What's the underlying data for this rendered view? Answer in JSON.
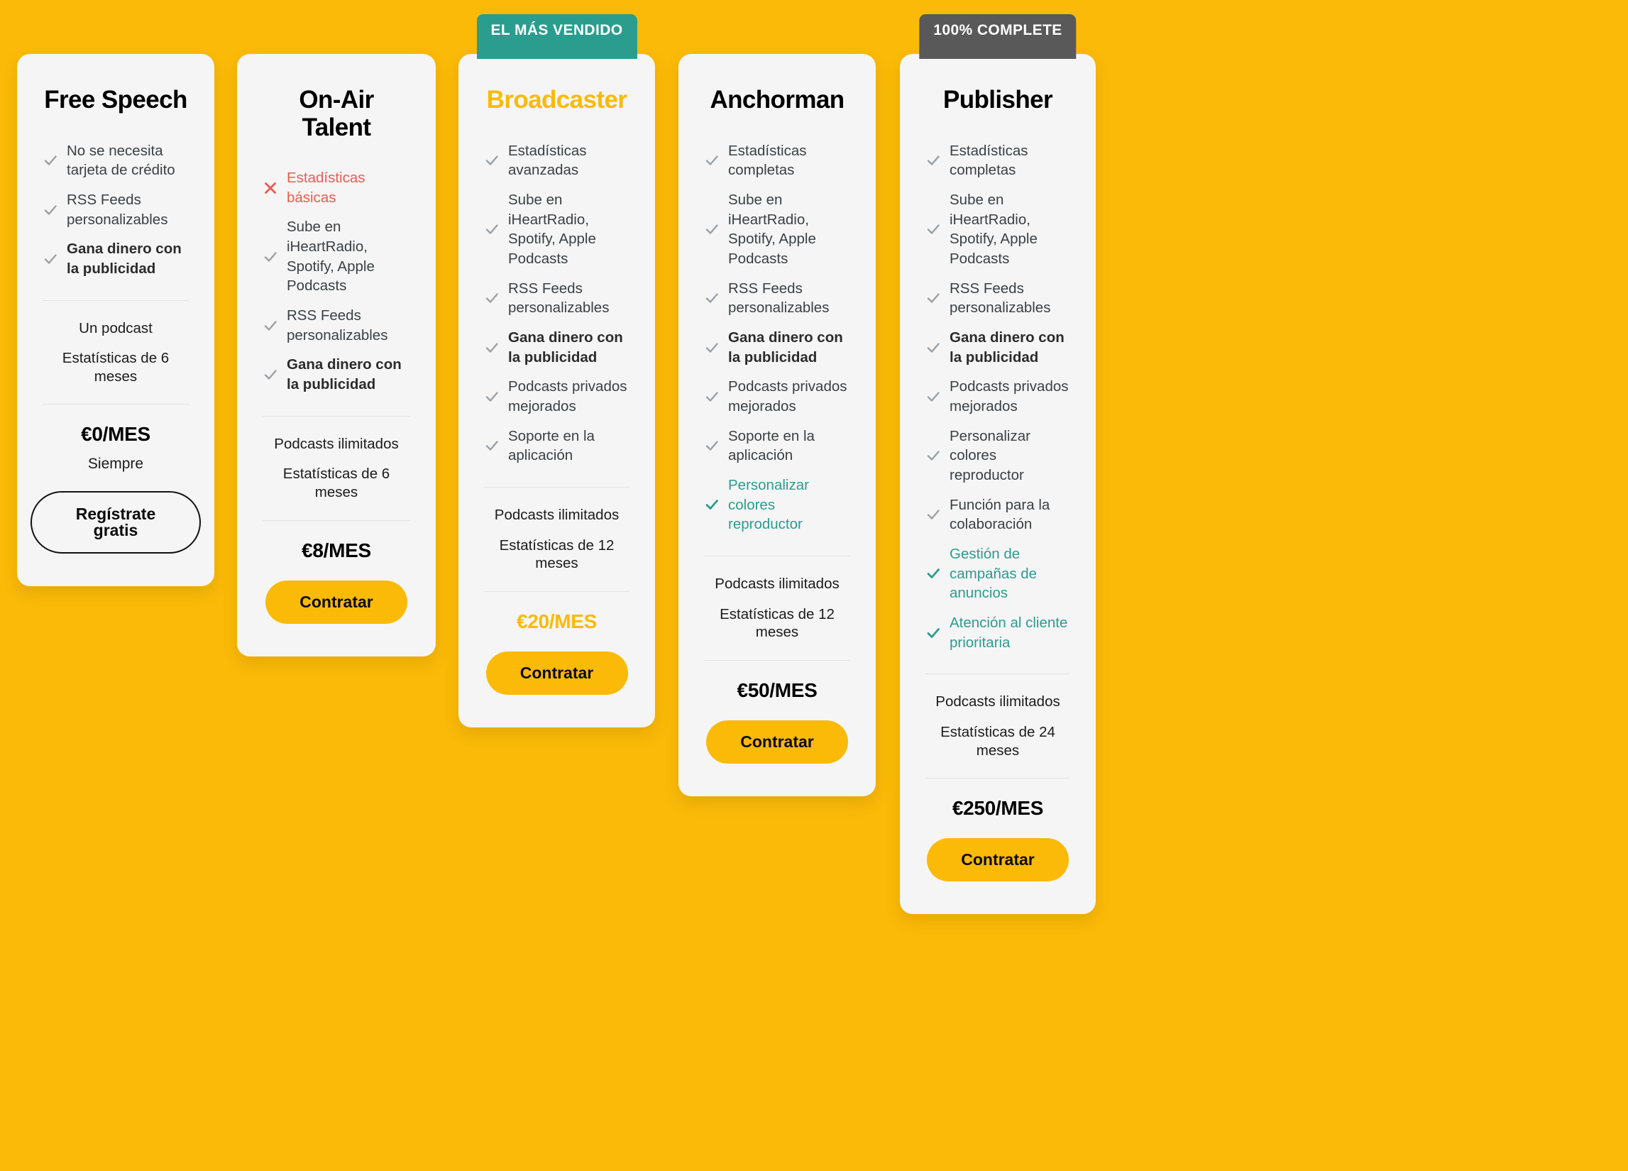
{
  "theme": {
    "background": "#FBBA07",
    "card_background": "#F5F5F5",
    "accent": "#FBBA07",
    "teal": "#2A9D8F",
    "badge_gray": "#595959",
    "negative": "#EE5A52",
    "text": "#3C4043"
  },
  "plans": [
    {
      "id": "free-speech",
      "badge": null,
      "title": "Free Speech",
      "title_accent": false,
      "features": [
        {
          "mark": "check",
          "text": "No se necesita tarjeta de crédito",
          "style": "normal"
        },
        {
          "mark": "check",
          "text": "RSS Feeds personalizables",
          "style": "normal"
        },
        {
          "mark": "check",
          "text": "Gana dinero con la publicidad",
          "style": "strong"
        }
      ],
      "specs": [
        "Un podcast",
        "Estatísticas de 6 meses"
      ],
      "price": "€0/MES",
      "price_accent": false,
      "price_note": "Siempre",
      "cta_label": "Regístrate gratis",
      "cta_style": "outline"
    },
    {
      "id": "on-air-talent",
      "badge": null,
      "title": "On-Air Talent",
      "title_accent": false,
      "features": [
        {
          "mark": "cross",
          "text": "Estadísticas básicas",
          "style": "negative"
        },
        {
          "mark": "check",
          "text": "Sube en iHeartRadio, Spotify, Apple Podcasts",
          "style": "normal"
        },
        {
          "mark": "check",
          "text": "RSS Feeds personalizables",
          "style": "normal"
        },
        {
          "mark": "check",
          "text": "Gana dinero con la publicidad",
          "style": "strong"
        }
      ],
      "specs": [
        "Podcasts ilimitados",
        "Estatísticas de 6 meses"
      ],
      "price": "€8/MES",
      "price_accent": false,
      "price_note": null,
      "cta_label": "Contratar",
      "cta_style": "solid"
    },
    {
      "id": "broadcaster",
      "badge": {
        "label": "EL MÁS VENDIDO",
        "variant": "bestseller"
      },
      "title": "Broadcaster",
      "title_accent": true,
      "features": [
        {
          "mark": "check",
          "text": "Estadísticas avanzadas",
          "style": "normal"
        },
        {
          "mark": "check",
          "text": "Sube en iHeartRadio, Spotify, Apple Podcasts",
          "style": "normal"
        },
        {
          "mark": "check",
          "text": "RSS Feeds personalizables",
          "style": "normal"
        },
        {
          "mark": "check",
          "text": "Gana dinero con la publicidad",
          "style": "strong"
        },
        {
          "mark": "check",
          "text": "Podcasts privados mejorados",
          "style": "normal"
        },
        {
          "mark": "check",
          "text": "Soporte en la aplicación",
          "style": "normal"
        }
      ],
      "specs": [
        "Podcasts ilimitados",
        "Estatísticas de 12 meses"
      ],
      "price": "€20/MES",
      "price_accent": true,
      "price_note": null,
      "cta_label": "Contratar",
      "cta_style": "solid"
    },
    {
      "id": "anchorman",
      "badge": null,
      "title": "Anchorman",
      "title_accent": false,
      "features": [
        {
          "mark": "check",
          "text": "Estadísticas completas",
          "style": "normal"
        },
        {
          "mark": "check",
          "text": "Sube en iHeartRadio, Spotify, Apple Podcasts",
          "style": "normal"
        },
        {
          "mark": "check",
          "text": "RSS Feeds personalizables",
          "style": "normal"
        },
        {
          "mark": "check",
          "text": "Gana dinero con la publicidad",
          "style": "strong"
        },
        {
          "mark": "check",
          "text": "Podcasts privados mejorados",
          "style": "normal"
        },
        {
          "mark": "check",
          "text": "Soporte en la aplicación",
          "style": "normal"
        },
        {
          "mark": "check-teal",
          "text": "Personalizar colores reproductor",
          "style": "highlight"
        }
      ],
      "specs": [
        "Podcasts ilimitados",
        "Estatísticas de 12 meses"
      ],
      "price": "€50/MES",
      "price_accent": false,
      "price_note": null,
      "cta_label": "Contratar",
      "cta_style": "solid"
    },
    {
      "id": "publisher",
      "badge": {
        "label": "100% COMPLETE",
        "variant": "complete"
      },
      "title": "Publisher",
      "title_accent": false,
      "features": [
        {
          "mark": "check",
          "text": "Estadísticas completas",
          "style": "normal"
        },
        {
          "mark": "check",
          "text": "Sube en iHeartRadio, Spotify, Apple Podcasts",
          "style": "normal"
        },
        {
          "mark": "check",
          "text": "RSS Feeds personalizables",
          "style": "normal"
        },
        {
          "mark": "check",
          "text": "Gana dinero con la publicidad",
          "style": "strong"
        },
        {
          "mark": "check",
          "text": "Podcasts privados mejorados",
          "style": "normal"
        },
        {
          "mark": "check",
          "text": "Personalizar colores reproductor",
          "style": "normal"
        },
        {
          "mark": "check",
          "text": "Función para la colaboración",
          "style": "normal"
        },
        {
          "mark": "check-teal",
          "text": "Gestión de campañas de anuncios",
          "style": "highlight"
        },
        {
          "mark": "check-teal",
          "text": "Atención al cliente prioritaria",
          "style": "highlight"
        }
      ],
      "specs": [
        "Podcasts ilimitados",
        "Estatísticas de 24 meses"
      ],
      "price": "€250/MES",
      "price_accent": false,
      "price_note": null,
      "cta_label": "Contratar",
      "cta_style": "solid"
    }
  ]
}
